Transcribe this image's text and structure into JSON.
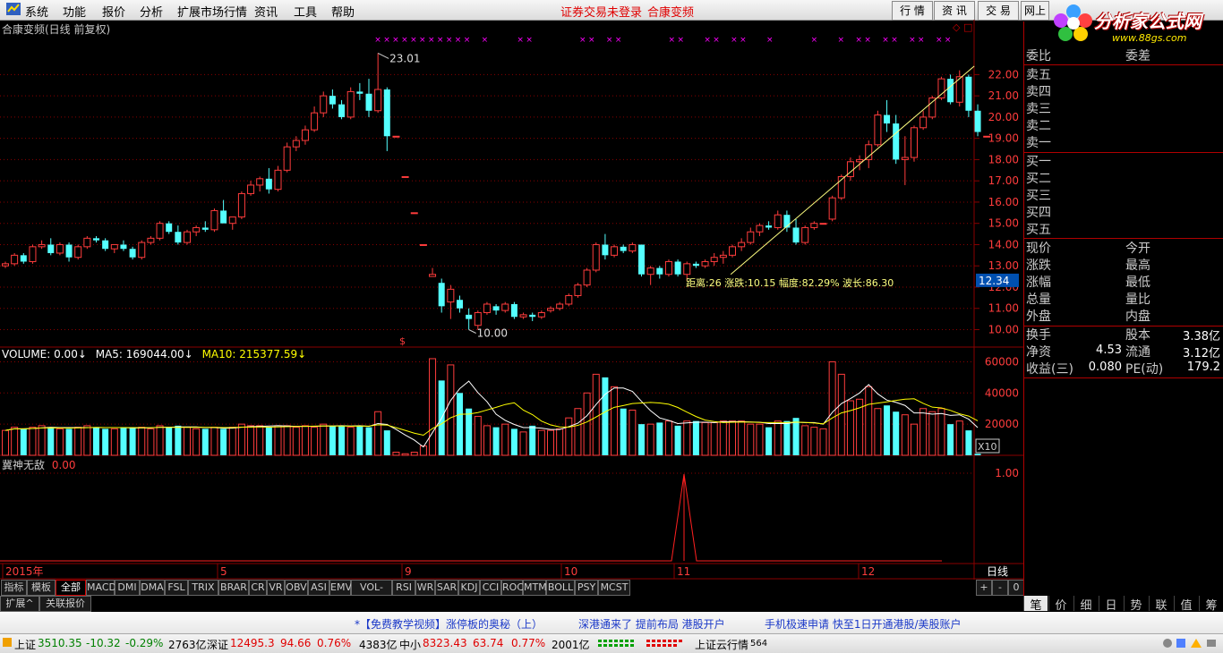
{
  "menu": {
    "items": [
      "系统",
      "功能",
      "报价",
      "分析",
      "扩展市场行情",
      "资讯",
      "工具",
      "帮助"
    ],
    "login_notice": "证券交易未登录",
    "stock_name_link": "合康变频",
    "right_buttons": [
      "行 情",
      "资 讯",
      "交 易",
      "网上"
    ]
  },
  "logo": {
    "text": "分析家公式网",
    "url_text": "www.88gs.com"
  },
  "main_chart": {
    "title": "合康变频(日线 前复权)",
    "high_label": "23.01",
    "low_label": "10.00",
    "price_ticks": [
      "22.00",
      "21.00",
      "20.00",
      "19.00",
      "18.00",
      "17.00",
      "16.00",
      "15.00",
      "14.00",
      "13.00",
      "12.00",
      "11.00",
      "10.00"
    ],
    "current_price_tag": "12.34",
    "measure_text": "距离:26 涨跌:10.15 幅度:82.29% 波长:86.30",
    "marker_text": "$",
    "buttons_symbol": "◇ □"
  },
  "chart_data": {
    "type": "candlestick",
    "price_range": [
      9.6,
      22.9
    ],
    "candles": [
      [
        13.0,
        13.2,
        12.9,
        13.1
      ],
      [
        13.1,
        13.6,
        13.0,
        13.5
      ],
      [
        13.5,
        13.6,
        13.1,
        13.2
      ],
      [
        13.2,
        14.0,
        13.1,
        13.9
      ],
      [
        13.9,
        14.2,
        13.8,
        14.0
      ],
      [
        14.0,
        14.3,
        13.5,
        13.6
      ],
      [
        13.6,
        14.1,
        13.5,
        14.0
      ],
      [
        14.0,
        14.1,
        13.2,
        13.4
      ],
      [
        13.4,
        14.0,
        13.3,
        13.9
      ],
      [
        13.9,
        14.4,
        13.8,
        14.3
      ],
      [
        14.3,
        14.4,
        14.1,
        14.2
      ],
      [
        14.2,
        14.3,
        13.7,
        13.8
      ],
      [
        13.8,
        14.0,
        13.6,
        14.0
      ],
      [
        14.0,
        14.2,
        13.7,
        13.8
      ],
      [
        13.8,
        13.9,
        13.3,
        13.4
      ],
      [
        13.4,
        14.2,
        13.3,
        14.1
      ],
      [
        14.1,
        14.4,
        14.0,
        14.3
      ],
      [
        14.3,
        15.1,
        14.2,
        15.0
      ],
      [
        15.0,
        15.1,
        14.5,
        14.6
      ],
      [
        14.6,
        14.9,
        14.0,
        14.1
      ],
      [
        14.1,
        14.7,
        14.0,
        14.6
      ],
      [
        14.6,
        14.9,
        14.4,
        14.8
      ],
      [
        14.8,
        15.1,
        14.6,
        14.7
      ],
      [
        14.7,
        15.7,
        14.6,
        15.6
      ],
      [
        15.6,
        16.1,
        15.4,
        15.0
      ],
      [
        15.0,
        15.3,
        14.7,
        15.3
      ],
      [
        15.3,
        16.5,
        15.2,
        16.4
      ],
      [
        16.4,
        17.0,
        16.3,
        16.8
      ],
      [
        16.8,
        17.2,
        16.5,
        17.1
      ],
      [
        17.1,
        17.6,
        16.4,
        16.6
      ],
      [
        16.6,
        17.7,
        16.5,
        17.5
      ],
      [
        17.5,
        18.8,
        17.4,
        18.6
      ],
      [
        18.6,
        19.1,
        18.4,
        18.9
      ],
      [
        18.9,
        19.6,
        18.7,
        19.4
      ],
      [
        19.4,
        20.5,
        19.3,
        20.2
      ],
      [
        20.2,
        21.2,
        20.0,
        21.0
      ],
      [
        21.0,
        21.3,
        20.4,
        20.6
      ],
      [
        20.6,
        20.8,
        19.9,
        20.0
      ],
      [
        20.0,
        21.4,
        19.9,
        21.2
      ],
      [
        21.2,
        21.6,
        20.8,
        21.1
      ],
      [
        21.1,
        21.8,
        20.0,
        20.3
      ],
      [
        20.3,
        23.01,
        20.2,
        21.3
      ],
      [
        21.3,
        21.4,
        18.4,
        19.1
      ],
      [
        19.1,
        19.1,
        19.1,
        19.1
      ],
      [
        17.2,
        17.2,
        17.2,
        17.2
      ],
      [
        15.5,
        15.5,
        15.5,
        15.5
      ],
      [
        14.0,
        14.0,
        14.0,
        14.0
      ],
      [
        12.5,
        12.9,
        12.5,
        12.6
      ],
      [
        12.2,
        12.4,
        10.8,
        11.1
      ],
      [
        11.3,
        12.1,
        10.5,
        11.9
      ],
      [
        11.4,
        11.6,
        10.8,
        11.0
      ],
      [
        10.7,
        11.0,
        10.0,
        10.5
      ],
      [
        10.2,
        10.9,
        10.0,
        10.8
      ],
      [
        10.8,
        11.3,
        10.7,
        11.2
      ],
      [
        11.1,
        11.2,
        10.7,
        10.9
      ],
      [
        10.9,
        11.3,
        10.8,
        11.2
      ],
      [
        11.2,
        11.3,
        10.5,
        10.6
      ],
      [
        10.6,
        10.8,
        10.5,
        10.7
      ],
      [
        10.7,
        10.8,
        10.4,
        10.6
      ],
      [
        10.6,
        10.9,
        10.5,
        10.8
      ],
      [
        10.9,
        11.1,
        10.8,
        11.0
      ],
      [
        11.0,
        11.3,
        10.9,
        11.2
      ],
      [
        11.2,
        11.7,
        11.1,
        11.6
      ],
      [
        11.6,
        12.2,
        11.5,
        12.1
      ],
      [
        12.1,
        12.9,
        12.0,
        12.8
      ],
      [
        12.8,
        14.1,
        12.7,
        14.0
      ],
      [
        14.0,
        14.5,
        13.3,
        13.5
      ],
      [
        13.5,
        14.0,
        13.4,
        13.9
      ],
      [
        13.9,
        14.0,
        13.6,
        13.7
      ],
      [
        13.7,
        14.1,
        13.6,
        14.0
      ],
      [
        14.0,
        14.0,
        12.5,
        12.6
      ],
      [
        12.6,
        13.0,
        12.1,
        12.9
      ],
      [
        12.9,
        13.0,
        12.4,
        12.6
      ],
      [
        12.6,
        13.3,
        12.5,
        13.2
      ],
      [
        13.2,
        13.3,
        12.5,
        12.6
      ],
      [
        12.6,
        13.2,
        12.3,
        13.1
      ],
      [
        13.1,
        13.2,
        12.9,
        13.0
      ],
      [
        13.0,
        13.3,
        12.9,
        13.2
      ],
      [
        13.2,
        13.6,
        13.0,
        13.4
      ],
      [
        13.4,
        13.7,
        13.1,
        13.5
      ],
      [
        13.5,
        14.0,
        13.4,
        13.9
      ],
      [
        13.9,
        14.3,
        13.7,
        14.1
      ],
      [
        14.1,
        14.8,
        14.0,
        14.6
      ],
      [
        14.6,
        15.0,
        14.4,
        14.9
      ],
      [
        14.9,
        15.1,
        14.7,
        14.8
      ],
      [
        14.8,
        15.6,
        14.7,
        15.4
      ],
      [
        15.4,
        15.6,
        14.6,
        14.8
      ],
      [
        14.8,
        15.2,
        14.0,
        14.1
      ],
      [
        14.1,
        14.9,
        14.0,
        14.8
      ],
      [
        14.8,
        15.1,
        14.7,
        15.0
      ],
      [
        15.0,
        15.0,
        15.0,
        15.0
      ],
      [
        15.2,
        16.3,
        15.1,
        16.2
      ],
      [
        16.2,
        17.3,
        16.1,
        17.2
      ],
      [
        17.2,
        18.1,
        17.0,
        17.9
      ],
      [
        17.9,
        18.2,
        17.5,
        18.0
      ],
      [
        18.0,
        18.9,
        17.6,
        18.7
      ],
      [
        18.7,
        20.3,
        18.6,
        20.1
      ],
      [
        20.1,
        20.8,
        19.3,
        19.7
      ],
      [
        19.7,
        20.1,
        17.8,
        18.0
      ],
      [
        18.0,
        19.1,
        16.8,
        18.1
      ],
      [
        18.1,
        19.6,
        17.9,
        19.5
      ],
      [
        19.5,
        20.3,
        19.4,
        20.0
      ],
      [
        20.0,
        21.0,
        19.9,
        20.9
      ],
      [
        20.9,
        21.9,
        20.8,
        21.8
      ],
      [
        21.8,
        22.0,
        20.6,
        20.7
      ],
      [
        20.7,
        22.2,
        20.5,
        21.9
      ],
      [
        21.9,
        22.0,
        20.0,
        20.3
      ],
      [
        20.3,
        20.6,
        19.1,
        19.3
      ],
      [
        19.1,
        19.1,
        19.1,
        19.1
      ]
    ],
    "trend_line": [
      [
        81,
        12.6
      ],
      [
        108,
        22.4
      ]
    ],
    "volume": {
      "label": "VOLUME: 0.00",
      "ma5_label": "MA5: 169044.00",
      "ma10_label": "MA10: 215377.59",
      "ticks": [
        "60000",
        "40000",
        "20000"
      ],
      "unit_tag": "X10",
      "range": [
        0,
        66000
      ]
    },
    "indicator": {
      "label": "冀神无敌",
      "value": "0.00",
      "tick": "1.00"
    },
    "date_axis": [
      "2015年",
      "5",
      "9",
      "10",
      "11",
      "12"
    ],
    "period_label": "日线"
  },
  "indicator_tabs": [
    "指标",
    "模板",
    "全部",
    "MACD",
    "DMI",
    "DMA",
    "FSL",
    "TRIX",
    "BRAR",
    "CR",
    "VR",
    "OBV",
    "ASI",
    "EMV",
    "VOL-TDX",
    "RSI",
    "WR",
    "SAR",
    "KDJ",
    "CCI",
    "ROC",
    "MTM",
    "BOLL",
    "PSY",
    "MCST"
  ],
  "bottom_tabs": [
    "扩展^",
    "关联报价"
  ],
  "zoom_controls": [
    "+",
    "-",
    "0"
  ],
  "right_panel": {
    "header": [
      "委比",
      "委差"
    ],
    "asks": [
      "卖五",
      "卖四",
      "卖三",
      "卖二",
      "卖一"
    ],
    "bids": [
      "买一",
      "买二",
      "买三",
      "买四",
      "买五"
    ],
    "stats": [
      [
        "现价",
        "今开"
      ],
      [
        "涨跌",
        "最高"
      ],
      [
        "涨幅",
        "最低"
      ],
      [
        "总量",
        "量比"
      ],
      [
        "外盘",
        "内盘"
      ]
    ],
    "fundamentals": [
      {
        "l": "换手",
        "v1": "",
        "r": "股本",
        "v2": "3.38亿"
      },
      {
        "l": "净资",
        "v1": "4.53",
        "r": "流通",
        "v2": "3.12亿"
      },
      {
        "l": "收益(三)",
        "v1": "0.080",
        "r": "PE(动)",
        "v2": "179.2"
      }
    ],
    "tabs": [
      "笔",
      "价",
      "细",
      "日",
      "势",
      "联",
      "值",
      "筹"
    ]
  },
  "news": {
    "items": [
      "*【免费教学视频】涨停板的奥秘（上）",
      "深港通来了  提前布局  港股开户",
      "手机极速申请  快至1日开通港股/美股账户"
    ]
  },
  "status": {
    "sh_label": "上证",
    "sh_price": "3510.35",
    "sh_chg": "-10.32",
    "sh_pct": "-0.29%",
    "sh_amt": "2763亿",
    "sz_label": "深证",
    "sz_price": "12495.3",
    "sz_chg": "94.66",
    "sz_pct": "0.76%",
    "sz_amt": "4383亿",
    "zx_label": "中小",
    "zx_price": "8323.43",
    "zx_chg": "63.74",
    "zx_pct": "0.77%",
    "zx_amt": "2001亿",
    "server": "上证云行情",
    "server_no": "564"
  },
  "colors": {
    "up": "#ff3c3c",
    "down": "#54ffff",
    "grid": "#8a0000",
    "ma5": "#ffffff",
    "ma10": "#ffff00",
    "label": "#ffffff"
  }
}
